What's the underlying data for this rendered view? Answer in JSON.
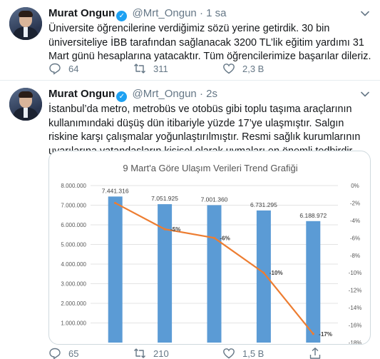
{
  "tweets": [
    {
      "author": "Murat Ongun",
      "handle": "@Mrt_Ongun",
      "separator": "·",
      "time": "1 sa",
      "text": "Üniversite öğrencilerine verdiğimiz sözü yerine getirdik. 30 bin üniversiteliye İBB tarafından sağlanacak 3200 TL’lik eğitim yardımı 31 Mart günü hesaplarına yatacaktır. Tüm öğrencilerimize başarılar dileriz.",
      "replies": "64",
      "retweets": "311",
      "likes": "2,3 B"
    },
    {
      "author": "Murat Ongun",
      "handle": "@Mrt_Ongun",
      "separator": "·",
      "time": "2s",
      "text": "İstanbul’da metro, metrobüs ve otobüs gibi toplu taşıma araçlarının kullanımındaki düşüş dün itibariyle yüzde 17’ye ulaşmıştır. Salgın riskine karşı çalışmalar yoğunlaştırılmıştır. Resmi sağlık kurumlarının uyarılarına vatandaşların kişisel olarak uymaları en önemli tedbirdir.",
      "replies": "65",
      "retweets": "210",
      "likes": "1,5 B"
    }
  ],
  "icons": {
    "verified": "verified-badge-icon",
    "chevron": "chevron-down-icon",
    "reply": "reply-icon",
    "retweet": "retweet-icon",
    "like": "heart-icon",
    "share": "share-icon"
  },
  "colors": {
    "bar": "#5b9bd5",
    "line": "#ed7d31",
    "icon": "#657786",
    "verified": "#1da1f2"
  },
  "chart_data": {
    "type": "bar",
    "title": "9 Mart'a Göre Ulaşım Verileri Trend Grafiği",
    "categories": [
      "",
      "",
      "",
      "",
      ""
    ],
    "series": [
      {
        "type": "bar",
        "values": [
          7441316,
          7051925,
          7001360,
          6731295,
          6188972
        ],
        "labels": [
          "7.441.316",
          "7.051.925",
          "7.001.360",
          "6.731.295",
          "6.188.972"
        ],
        "axis": "left"
      },
      {
        "type": "line",
        "values": [
          -2,
          -5,
          -6,
          -10,
          -17
        ],
        "labels": [
          "",
          "-5%",
          "-6%",
          "-10%",
          "-17%"
        ],
        "axis": "right"
      }
    ],
    "ylim_left": [
      0,
      8000000
    ],
    "yticks_left": [
      "1.000.000",
      "2.000.000",
      "3.000.000",
      "4.000.000",
      "5.000.000",
      "6.000.000",
      "7.000.000",
      "8.000.000"
    ],
    "ylim_right": [
      -18,
      0
    ],
    "yticks_right": [
      "0%",
      "-2%",
      "-4%",
      "-6%",
      "-8%",
      "-10%",
      "-12%",
      "-14%",
      "-16%",
      "-18%"
    ],
    "grid": true,
    "legend": "none"
  }
}
